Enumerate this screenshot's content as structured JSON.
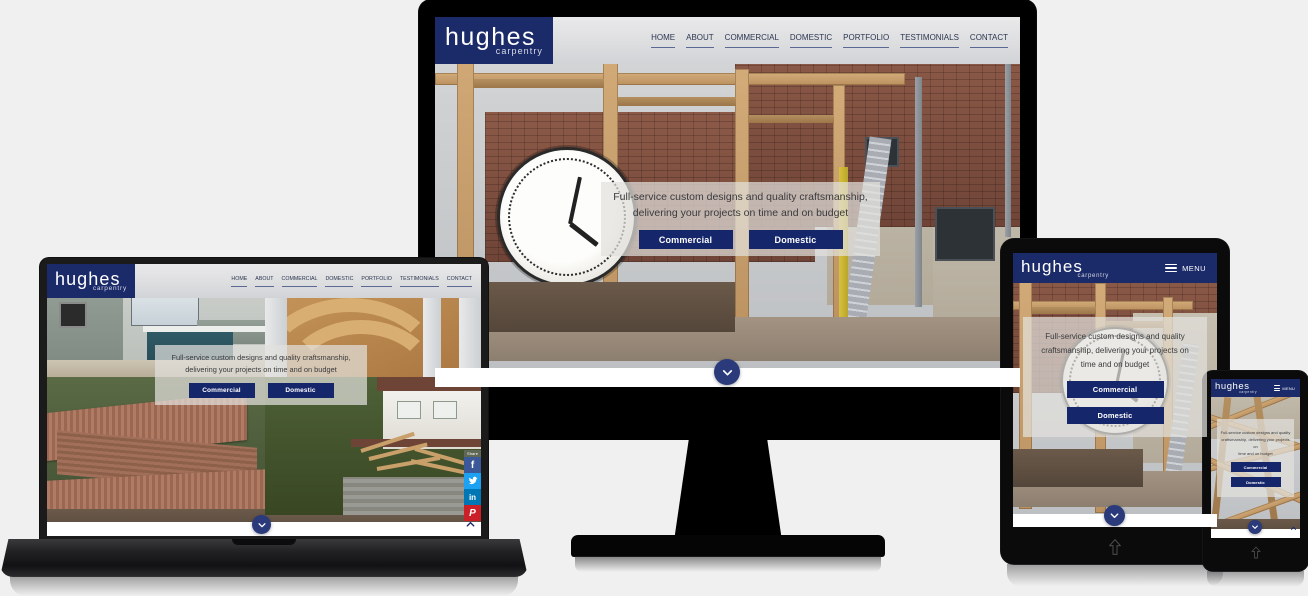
{
  "brand": {
    "logo_main": "hughes",
    "logo_sub": "carpentry",
    "navy": "#16266b",
    "logo_navy": "#1b2a68"
  },
  "nav": {
    "items": [
      {
        "label": "HOME"
      },
      {
        "label": "ABOUT"
      },
      {
        "label": "COMMERCIAL"
      },
      {
        "label": "DOMESTIC"
      },
      {
        "label": "PORTFOLIO"
      },
      {
        "label": "TESTIMONIALS"
      },
      {
        "label": "CONTACT"
      }
    ],
    "mobile_menu_label": "MENU",
    "mobile_menu_icon": "hamburger-icon"
  },
  "hero": {
    "headline_line1": "Full-service custom designs and quality craftsmanship,",
    "headline_line2": "delivering your projects on time and on budget",
    "headline_tablet_line1": "Full-service custom designs and quality",
    "headline_tablet_line2": "craftsmanship, delivering your projects on",
    "headline_tablet_line3": "time and on budget",
    "cta_primary": "Commercial",
    "cta_secondary": "Domestic",
    "scroll_icon": "chevron-down-icon",
    "scroll_top_icon": "chevron-up-icon"
  },
  "share": {
    "label": "Share",
    "items": [
      {
        "name": "facebook",
        "glyph": "f",
        "color": "#3b5998"
      },
      {
        "name": "twitter",
        "glyph": "t",
        "color": "#1da1f2"
      },
      {
        "name": "linkedin",
        "glyph": "in",
        "color": "#0077b5"
      },
      {
        "name": "pinterest",
        "glyph": "P",
        "color": "#cb2027"
      }
    ]
  },
  "devices": {
    "desktop": "desktop-monitor",
    "laptop": "laptop",
    "tablet": "tablet",
    "phone": "phone"
  },
  "home_indicator": "↑"
}
